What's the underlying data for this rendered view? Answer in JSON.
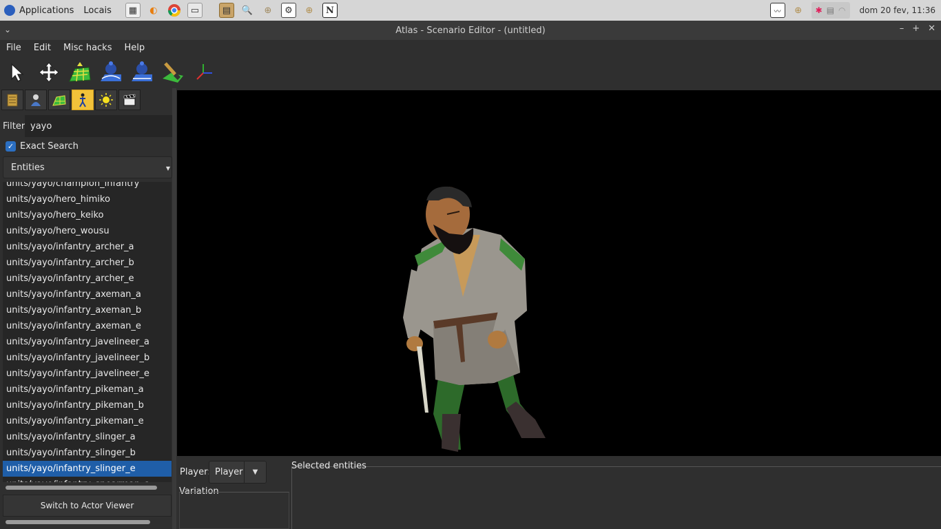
{
  "top_panel": {
    "applications_label": "Applications",
    "places_label": "Locais",
    "clock": "dom 20 fev, 11:36",
    "launchers": [
      "file-manager-icon",
      "blender-icon",
      "chrome-icon",
      "folder-icon",
      "archive-icon",
      "search-icon",
      "target-icon",
      "settings-icon",
      "crosshair-icon",
      "notion-icon"
    ]
  },
  "window": {
    "title": "Atlas - Scenario Editor - (untitled)"
  },
  "menu": [
    "File",
    "Edit",
    "Misc hacks",
    "Help"
  ],
  "toolbar": {
    "tools": [
      "select-tool-icon",
      "move-tool-icon",
      "terrain-elevate-icon",
      "terrain-smooth-icon",
      "terrain-flatten-icon",
      "paint-tool-icon",
      "axes-tool-icon"
    ]
  },
  "sidebar": {
    "tabs": [
      "map-tab-icon",
      "player-tab-icon",
      "terrain-tab-icon",
      "object-tab-icon",
      "environment-tab-icon",
      "cinematic-tab-icon"
    ],
    "filter_label": "Filter",
    "filter_value": "yayo",
    "exact_search_label": "Exact Search",
    "exact_search_checked": true,
    "type_select_value": "Entities",
    "entities": [
      "units/yayo/champion_infantry",
      "units/yayo/hero_himiko",
      "units/yayo/hero_keiko",
      "units/yayo/hero_wousu",
      "units/yayo/infantry_archer_a",
      "units/yayo/infantry_archer_b",
      "units/yayo/infantry_archer_e",
      "units/yayo/infantry_axeman_a",
      "units/yayo/infantry_axeman_b",
      "units/yayo/infantry_axeman_e",
      "units/yayo/infantry_javelineer_a",
      "units/yayo/infantry_javelineer_b",
      "units/yayo/infantry_javelineer_e",
      "units/yayo/infantry_pikeman_a",
      "units/yayo/infantry_pikeman_b",
      "units/yayo/infantry_pikeman_e",
      "units/yayo/infantry_slinger_a",
      "units/yayo/infantry_slinger_b",
      "units/yayo/infantry_slinger_e",
      "units/yayo/infantry_spearman_a"
    ],
    "selected_entity": "units/yayo/infantry_slinger_e",
    "switch_button_label": "Switch to Actor Viewer"
  },
  "bottom_panel": {
    "player_label": "Player:",
    "player_value": "Player",
    "variation_label": "Variation",
    "selected_entities_label": "Selected entities"
  },
  "colors": {
    "accent": "#1f5ea8",
    "active_tab": "#f2c23a",
    "background": "#2f2f2f"
  }
}
